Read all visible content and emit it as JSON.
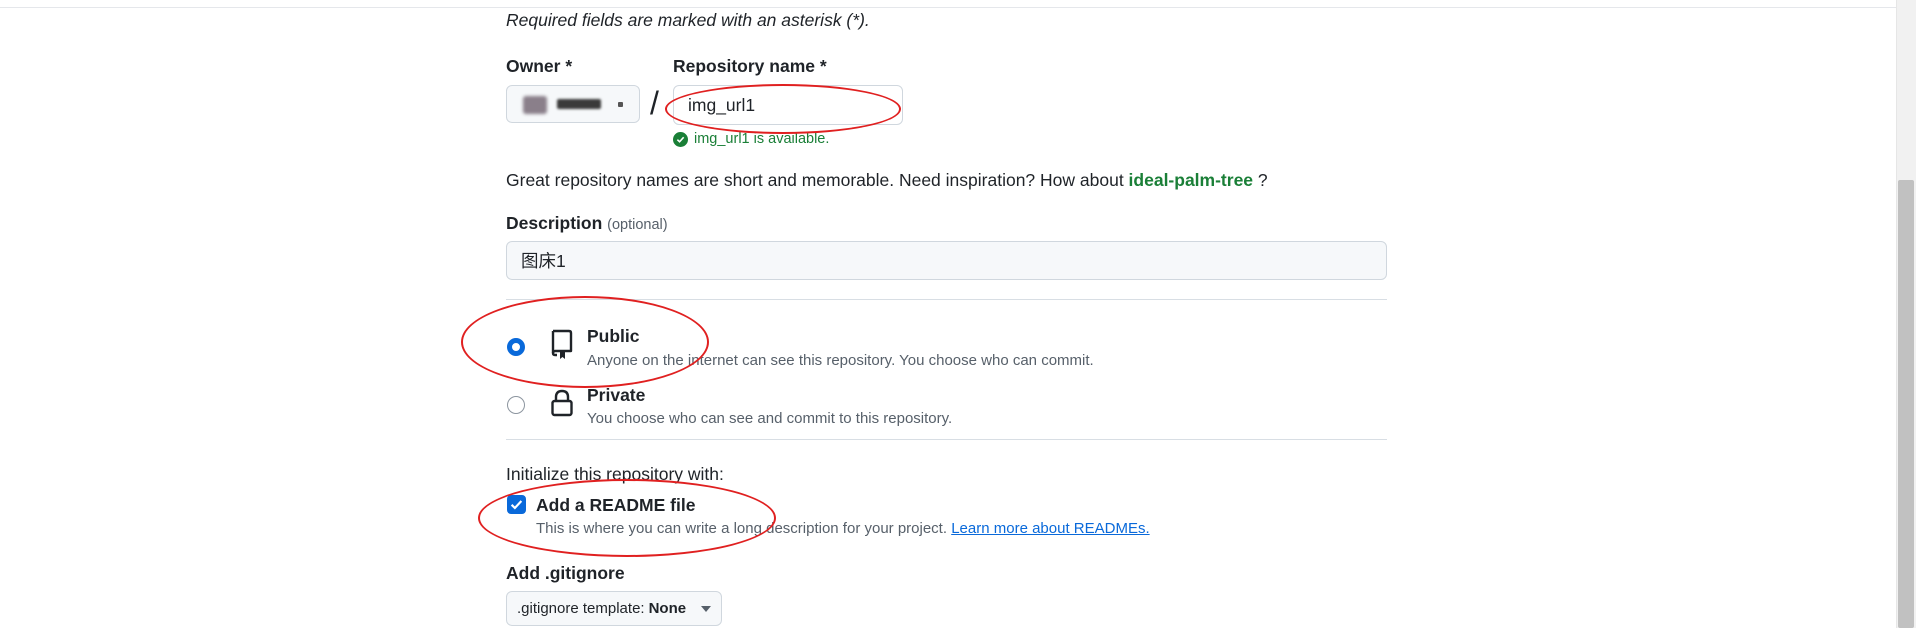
{
  "form": {
    "required_note": "Required fields are marked with an asterisk (*).",
    "owner_label": "Owner *",
    "repo_name_label": "Repository name *",
    "separator": "/",
    "repo_name_value": "img_url1",
    "availability": "img_url1 is available.",
    "hint_prefix": "Great repository names are short and memorable. Need inspiration? How about ",
    "hint_suggestion": "ideal-palm-tree",
    "hint_suffix": " ?",
    "description_label": "Description",
    "description_optional": "(optional)",
    "description_value": "图床1"
  },
  "visibility": {
    "selected": "public",
    "options": [
      {
        "id": "public",
        "title": "Public",
        "description": "Anyone on the internet can see this repository. You choose who can commit.",
        "icon": "repo-icon"
      },
      {
        "id": "private",
        "title": "Private",
        "description": "You choose who can see and commit to this repository.",
        "icon": "lock-icon"
      }
    ]
  },
  "initialize": {
    "heading": "Initialize this repository with:",
    "readme_label": "Add a README file",
    "readme_checked": true,
    "readme_desc": "This is where you can write a long description for your project. ",
    "readme_link": "Learn more about READMEs."
  },
  "gitignore": {
    "heading": "Add .gitignore",
    "select_prefix": ".gitignore template:",
    "select_value": "None"
  },
  "colors": {
    "accent": "#0969da",
    "success": "#1a7f37",
    "annotation": "#e02020"
  }
}
